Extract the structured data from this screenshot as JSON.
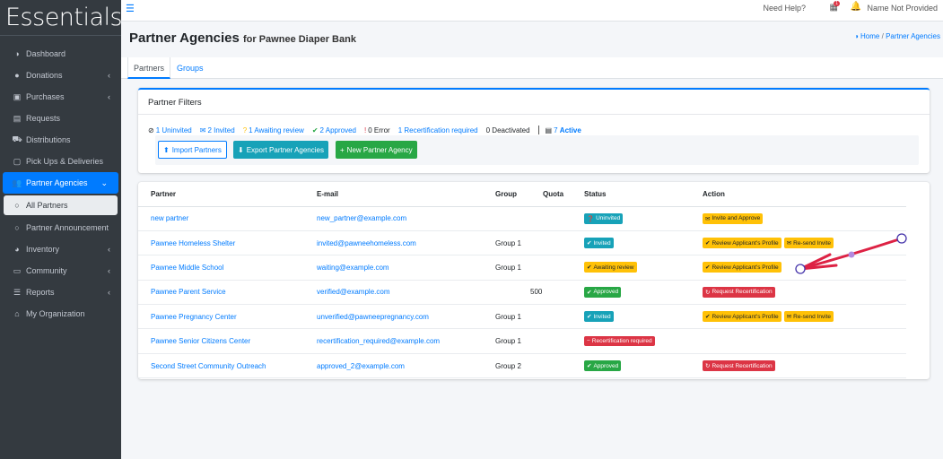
{
  "app": {
    "brand": "Essentials"
  },
  "sidebar": {
    "items": [
      {
        "label": "Dashboard",
        "icon": "dashboard-icon",
        "glyph": "◑",
        "caret": ""
      },
      {
        "label": "Donations",
        "icon": "donation-icon",
        "glyph": "●",
        "caret": "‹"
      },
      {
        "label": "Purchases",
        "icon": "money-icon",
        "glyph": "▣",
        "caret": "‹"
      },
      {
        "label": "Requests",
        "icon": "file-icon",
        "glyph": "▤",
        "caret": ""
      },
      {
        "label": "Distributions",
        "icon": "cart-icon",
        "glyph": "⛟",
        "caret": ""
      },
      {
        "label": "Pick Ups & Deliveries",
        "icon": "calendar-icon",
        "glyph": "▢",
        "caret": ""
      },
      {
        "label": "Partner Agencies",
        "icon": "users-icon",
        "glyph": "👥",
        "caret": "⌄"
      },
      {
        "label": "All Partners",
        "icon": "circle-icon",
        "glyph": "○",
        "caret": ""
      },
      {
        "label": "Partner Announcement",
        "icon": "circle-icon",
        "glyph": "○",
        "caret": ""
      },
      {
        "label": "Inventory",
        "icon": "pie-chart-icon",
        "glyph": "◕",
        "caret": "‹"
      },
      {
        "label": "Community",
        "icon": "laptop-icon",
        "glyph": "▭",
        "caret": "‹"
      },
      {
        "label": "Reports",
        "icon": "list-icon",
        "glyph": "☰",
        "caret": "‹"
      },
      {
        "label": "My Organization",
        "icon": "home-icon",
        "glyph": "⌂",
        "caret": ""
      }
    ]
  },
  "topbar": {
    "need_help": "Need Help?",
    "calendar_badge": "1",
    "user_name": "Name Not Provided"
  },
  "header": {
    "title": "Partner Agencies",
    "subtitle": "for Pawnee Diaper Bank",
    "breadcrumb_home": "Home",
    "breadcrumb_sep": "/",
    "breadcrumb_current": "Partner Agencies"
  },
  "tabs": [
    {
      "label": "Partners"
    },
    {
      "label": "Groups"
    }
  ],
  "filters": {
    "title": "Partner Filters",
    "items": [
      {
        "label": "1 Uninvited",
        "glyph": "⊘",
        "color": "#007bff",
        "icon_color": "#212529"
      },
      {
        "label": "2 Invited",
        "glyph": "✉",
        "color": "#007bff",
        "icon_color": "#007bff"
      },
      {
        "label": "1 Awaiting review",
        "glyph": "?",
        "color": "#007bff",
        "icon_color": "#ffc107"
      },
      {
        "label": "2 Approved",
        "glyph": "✔",
        "color": "#007bff",
        "icon_color": "#28a745"
      },
      {
        "label": "0 Error",
        "glyph": "!",
        "color": "#212529",
        "icon_color": "#dc3545"
      },
      {
        "label": "1 Recertification required",
        "glyph": "",
        "color": "#007bff",
        "icon_color": "#007bff"
      },
      {
        "label": "0 Deactivated",
        "glyph": "",
        "color": "#212529",
        "icon_color": "#212529"
      }
    ],
    "active_prefix": "7",
    "active_label": "Active",
    "buttons": {
      "import": "Import Partners",
      "export": "Export Partner Agencies",
      "new": "New Partner Agency"
    }
  },
  "table": {
    "headers": [
      "Partner",
      "E-mail",
      "Group",
      "Quota",
      "Status",
      "Action"
    ],
    "rows": [
      {
        "partner": "new partner",
        "email": "new_partner@example.com",
        "group": "",
        "quota": "",
        "status": "Uninvited",
        "status_class": "b-info",
        "status_glyph": "❓",
        "actions": [
          {
            "label": "Invite and Approve",
            "cls": "b-warning",
            "glyph": "✉"
          }
        ]
      },
      {
        "partner": "Pawnee Homeless Shelter",
        "email": "invited@pawneehomeless.com",
        "group": "Group 1",
        "quota": "",
        "status": "Invited",
        "status_class": "b-info",
        "status_glyph": "✔",
        "actions": [
          {
            "label": "Review Applicant's Profile",
            "cls": "b-warning",
            "glyph": "✔"
          },
          {
            "label": "Re-send Invite",
            "cls": "b-warning",
            "glyph": "✉"
          }
        ]
      },
      {
        "partner": "Pawnee Middle School",
        "email": "waiting@example.com",
        "group": "Group 1",
        "quota": "",
        "status": "Awaiting review",
        "status_class": "b-warning",
        "status_glyph": "✔",
        "actions": [
          {
            "label": "Review Applicant's Profile",
            "cls": "b-warning",
            "glyph": "✔"
          }
        ]
      },
      {
        "partner": "Pawnee Parent Service",
        "email": "verified@example.com",
        "group": "",
        "quota": "500",
        "status": "Approved",
        "status_class": "b-success",
        "status_glyph": "✔",
        "actions": [
          {
            "label": "Request Recertification",
            "cls": "b-danger",
            "glyph": "↻"
          }
        ]
      },
      {
        "partner": "Pawnee Pregnancy Center",
        "email": "unverified@pawneepregnancy.com",
        "group": "Group 1",
        "quota": "",
        "status": "Invited",
        "status_class": "b-info",
        "status_glyph": "✔",
        "actions": [
          {
            "label": "Review Applicant's Profile",
            "cls": "b-warning",
            "glyph": "✔"
          },
          {
            "label": "Re-send Invite",
            "cls": "b-warning",
            "glyph": "✉"
          }
        ]
      },
      {
        "partner": "Pawnee Senior Citizens Center",
        "email": "recertification_required@example.com",
        "group": "Group 1",
        "quota": "",
        "status": "Recertification required",
        "status_class": "b-danger",
        "status_glyph": "−",
        "actions": []
      },
      {
        "partner": "Second Street Community Outreach",
        "email": "approved_2@example.com",
        "group": "Group 2",
        "quota": "",
        "status": "Approved",
        "status_class": "b-success",
        "status_glyph": "✔",
        "actions": [
          {
            "label": "Request Recertification",
            "cls": "b-danger",
            "glyph": "↻"
          }
        ]
      }
    ]
  },
  "colors": {
    "sidebar_bg": "#343a40",
    "primary": "#007bff",
    "annotation": "#dd2244"
  }
}
